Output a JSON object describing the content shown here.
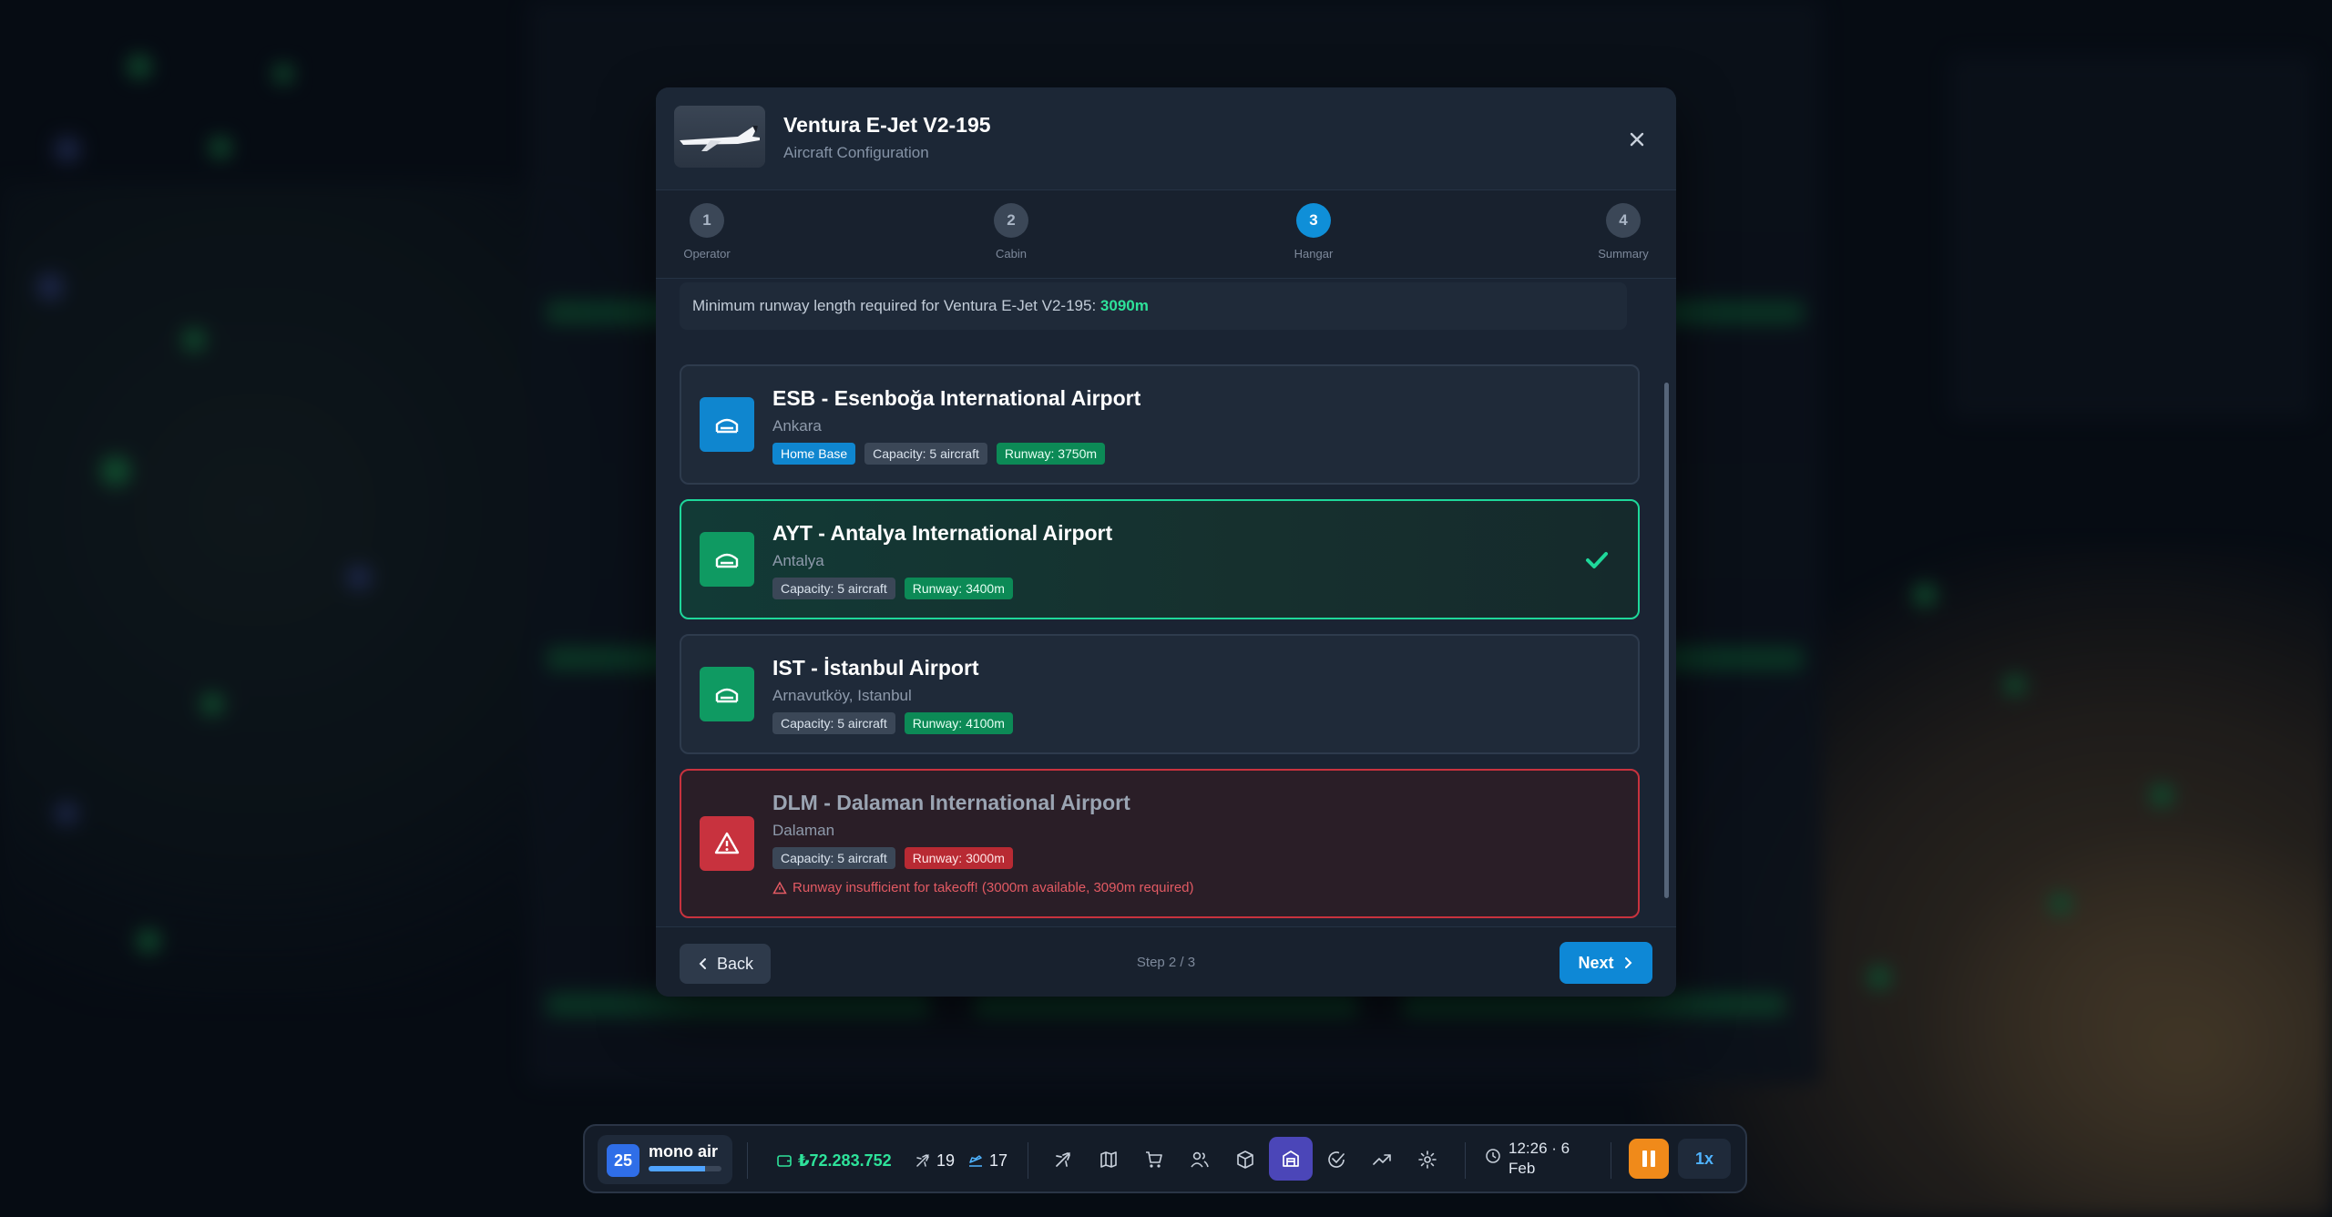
{
  "modal": {
    "title": "Ventura E-Jet V2-195",
    "subtitle": "Aircraft Configuration"
  },
  "steps": [
    {
      "num": "1",
      "label": "Operator"
    },
    {
      "num": "2",
      "label": "Cabin"
    },
    {
      "num": "3",
      "label": "Hangar"
    },
    {
      "num": "4",
      "label": "Summary"
    }
  ],
  "notice": {
    "text": "Minimum runway length required for Ventura E-Jet V2-195:",
    "value": "3090m"
  },
  "airports": [
    {
      "name": "ESB - Esenboğa International Airport",
      "city": "Ankara",
      "home": "Home Base",
      "capacity": "Capacity: 5 aircraft",
      "runway": "Runway: 3750m"
    },
    {
      "name": "AYT - Antalya International Airport",
      "city": "Antalya",
      "capacity": "Capacity: 5 aircraft",
      "runway": "Runway: 3400m"
    },
    {
      "name": "IST - İstanbul Airport",
      "city": "Arnavutköy, Istanbul",
      "capacity": "Capacity: 5 aircraft",
      "runway": "Runway: 4100m"
    },
    {
      "name": "DLM - Dalaman International Airport",
      "city": "Dalaman",
      "capacity": "Capacity: 5 aircraft",
      "runway": "Runway: 3000m",
      "warning": "Runway insufficient for takeoff! (3000m available, 3090m required)"
    }
  ],
  "footer": {
    "back": "Back",
    "step_count": "Step 2 / 3",
    "next": "Next"
  },
  "toolbar": {
    "level": "25",
    "company": "mono air",
    "xp_fraction": 0.78,
    "money": "₺72.283.752",
    "planes_count": "19",
    "flights_count": "17",
    "time": "12:26 · 6",
    "month": "Feb",
    "speed": "1x"
  },
  "colors": {
    "accent": "#0e88d6",
    "success": "#1ed89a",
    "danger": "#c8323e",
    "home_icon": "#0f86cf",
    "airport_icon": "#0f9a62",
    "pause": "#f08a1a"
  }
}
